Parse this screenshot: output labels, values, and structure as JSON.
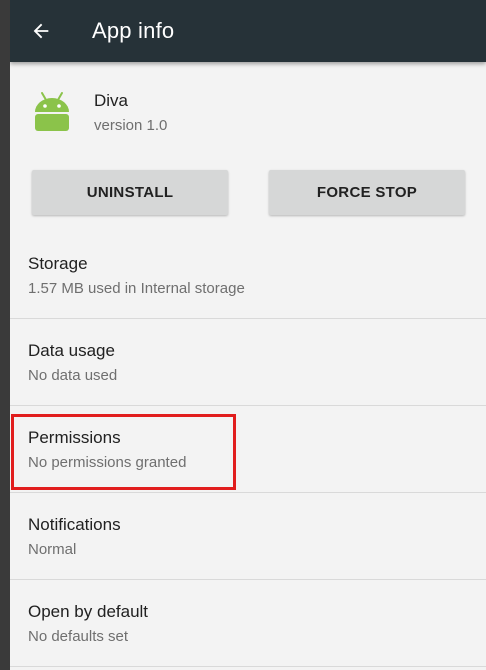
{
  "appbar": {
    "title": "App info",
    "back_icon": "arrow-back-icon",
    "background": "#263238"
  },
  "app": {
    "name": "Diva",
    "version": "version 1.0",
    "icon": "android-robot-icon",
    "icon_color": "#8bc34a"
  },
  "buttons": {
    "uninstall": "UNINSTALL",
    "force_stop": "FORCE STOP"
  },
  "settings": {
    "storage": {
      "title": "Storage",
      "subtitle": "1.57 MB used in Internal storage"
    },
    "data_usage": {
      "title": "Data usage",
      "subtitle": "No data used"
    },
    "permissions": {
      "title": "Permissions",
      "subtitle": "No permissions granted"
    },
    "notifications": {
      "title": "Notifications",
      "subtitle": "Normal"
    },
    "open_by_default": {
      "title": "Open by default",
      "subtitle": "No defaults set"
    }
  },
  "highlight": {
    "target": "permissions",
    "color": "#e11d1d"
  }
}
